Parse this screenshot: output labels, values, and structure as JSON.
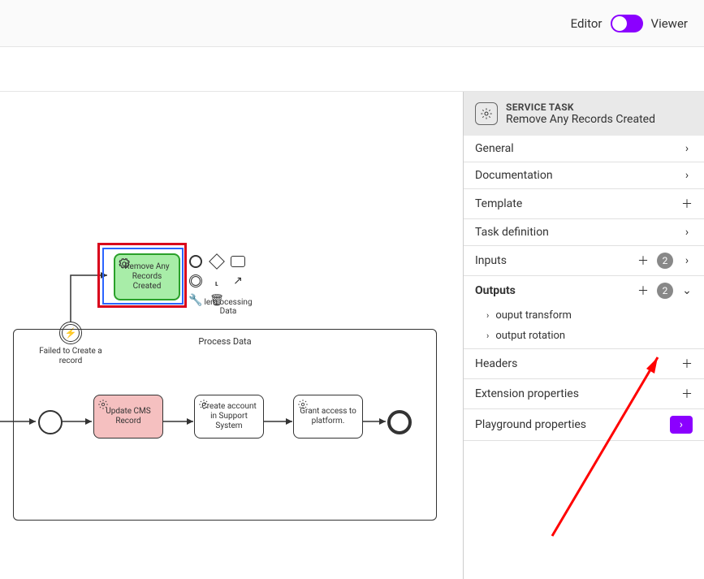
{
  "header": {
    "mode_left": "Editor",
    "mode_right": "Viewer"
  },
  "canvas": {
    "selected_task": {
      "label": "Remove Any Records Created"
    },
    "error_event_label": "Failed to Create a record",
    "subprocess_label": "Process Data",
    "tasks": {
      "update_cms": "Update CMS Record",
      "create_account": "Create account in Support System",
      "grant_access": "Grant access to platform."
    },
    "toolbox_label": " lem  ocessing Data"
  },
  "panel": {
    "header": {
      "type": "SERVICE TASK",
      "name": "Remove Any Records Created"
    },
    "rows": {
      "general": "General",
      "documentation": "Documentation",
      "template": "Template",
      "task_definition": "Task definition",
      "inputs": "Inputs",
      "inputs_count": "2",
      "outputs": "Outputs",
      "outputs_count": "2",
      "output_items": {
        "transform": "ouput transform",
        "rotation": "output rotation"
      },
      "headers": "Headers",
      "extension": "Extension properties",
      "playground": "Playground properties"
    }
  }
}
